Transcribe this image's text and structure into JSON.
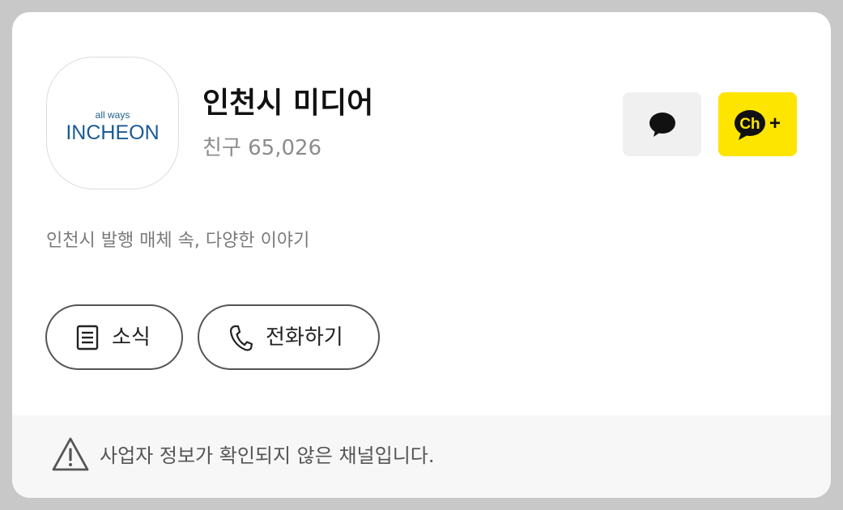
{
  "channel": {
    "logo_small_text": "all ways",
    "logo_main_text": "INCHEON",
    "name": "인천시 미디어",
    "friends": "친구 65,026",
    "description": "인천시 발행 매체 속, 다양한 이야기"
  },
  "actions": {
    "chat_icon": "speech-bubble-icon",
    "add_channel_icon": "channel-add-icon",
    "add_channel_text": "Ch",
    "add_channel_plus": "+"
  },
  "buttons": {
    "news_label": "소식",
    "news_icon": "document-icon",
    "call_label": "전화하기",
    "call_icon": "phone-icon"
  },
  "footer": {
    "warning_icon": "warning-icon",
    "text": "사업자 정보가 확인되지 않은 채널입니다."
  },
  "colors": {
    "add_button_bg": "#fee500",
    "chat_button_bg": "#f0f0f0",
    "logo_blue": "#1a5a96"
  }
}
